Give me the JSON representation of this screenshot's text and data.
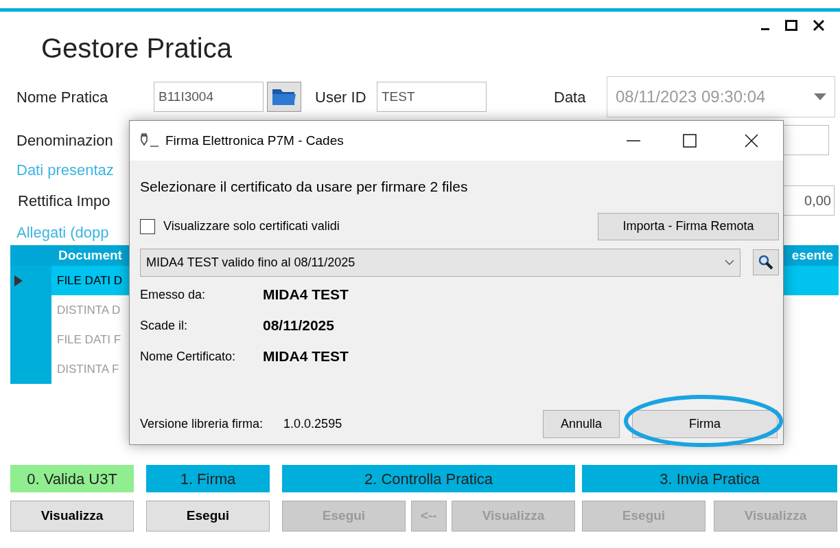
{
  "window": {
    "title": "Gestore Pratica"
  },
  "form": {
    "nome_pratica": {
      "label": "Nome Pratica",
      "value": "B11I3004"
    },
    "user_id": {
      "label": "User ID",
      "value": "TEST"
    },
    "data": {
      "label": "Data",
      "value": "08/11/2023 09:30:04"
    },
    "denominazione": {
      "label": "Denominazion"
    },
    "dati_presentazione": "Dati presentaz",
    "rettifica": {
      "label": "Rettifica Impo",
      "value": "0,00"
    },
    "allegati": "Allegati (dopp"
  },
  "table": {
    "columns": [
      "Document",
      "esente"
    ],
    "rows": [
      {
        "cell": "FILE DATI D",
        "selected": true
      },
      {
        "cell": "DISTINTA D",
        "selected": false
      },
      {
        "cell": "FILE DATI F",
        "selected": false
      },
      {
        "cell": "DISTINTA F",
        "selected": false
      }
    ]
  },
  "steps": [
    {
      "label": "0. Valida U3T",
      "color": "#90ee90",
      "buttons": [
        {
          "label": "Visualizza",
          "disabled": false
        }
      ]
    },
    {
      "label": "1. Firma",
      "color": "#00aedb",
      "buttons": [
        {
          "label": "Esegui",
          "disabled": false
        }
      ]
    },
    {
      "label": "2. Controlla Pratica",
      "color": "#00aedb",
      "buttons": [
        {
          "label": "Esegui",
          "disabled": true
        },
        {
          "label": "<--",
          "disabled": true
        },
        {
          "label": "Visualizza",
          "disabled": true
        }
      ]
    },
    {
      "label": "3. Invia Pratica",
      "color": "#00aedb",
      "buttons": [
        {
          "label": "Esegui",
          "disabled": true
        },
        {
          "label": "Visualizza",
          "disabled": true
        }
      ]
    }
  ],
  "dialog": {
    "title": "Firma Elettronica P7M - Cades",
    "heading": "Selezionare il certificato da usare per firmare 2 files",
    "only_valid": {
      "label": "Visualizzare solo certificati validi",
      "checked": false
    },
    "import_button": "Importa - Firma Remota",
    "certificate": "MIDA4 TEST valido fino al 08/11/2025",
    "details": [
      {
        "label": "Emesso da:",
        "value": "MIDA4 TEST"
      },
      {
        "label": "Scade il:",
        "value": "08/11/2025"
      },
      {
        "label": "Nome Certificato:",
        "value": "MIDA4 TEST"
      }
    ],
    "version": {
      "label": "Versione libreria firma:",
      "value": "1.0.0.2595"
    },
    "buttons": [
      {
        "label": "Annulla",
        "highlighted": false
      },
      {
        "label": "Firma",
        "highlighted": true
      }
    ]
  }
}
